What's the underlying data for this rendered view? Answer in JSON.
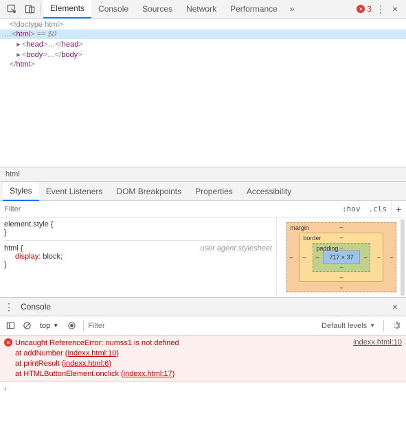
{
  "topbar": {
    "tabs": [
      "Elements",
      "Console",
      "Sources",
      "Network",
      "Performance"
    ],
    "active_tab": 0,
    "error_count": "3"
  },
  "dom": {
    "doctype": "<!doctype html>",
    "html_open": "html",
    "eq0": " == $0",
    "head_open": "head",
    "head_ellipsis": "…",
    "head_close": "head",
    "body_open": "body",
    "body_ellipsis": "…",
    "body_close": "body",
    "html_close": "html"
  },
  "breadcrumb": "html",
  "subtabs": {
    "items": [
      "Styles",
      "Event Listeners",
      "DOM Breakpoints",
      "Properties",
      "Accessibility"
    ],
    "active": 0
  },
  "styles_toolbar": {
    "filter_placeholder": "Filter",
    "hov": ":hov",
    "cls": ".cls"
  },
  "styles_rules": {
    "element_style": "element.style {",
    "close1": "}",
    "html_selector": "html {",
    "ua_label": "user agent stylesheet",
    "prop_name": "display",
    "prop_val": "block",
    "close2": "}"
  },
  "boxmodel": {
    "margin": {
      "label": "margin",
      "t": "–",
      "r": "–",
      "b": "–",
      "l": "–"
    },
    "border": {
      "label": "border",
      "t": "–",
      "r": "–",
      "b": "–",
      "l": "–"
    },
    "padding": {
      "label": "padding",
      "t": "–",
      "r": "–",
      "b": "–",
      "l": "–"
    },
    "content": "717 × 37"
  },
  "drawer": {
    "title": "Console"
  },
  "console_toolbar": {
    "context": "top",
    "filter_placeholder": "Filter",
    "levels": "Default levels"
  },
  "console_msg": {
    "error_title": "Uncaught ReferenceError: numss1 is not defined",
    "at1_pre": "    at addNumber (",
    "at1_link": "indexx.html:10",
    "at2_pre": "    at printResult (",
    "at2_link": "indexx.html:6",
    "at3_pre": "    at HTMLButtonElement.onclick (",
    "at3_link": "indexx.html:17",
    "paren_close": ")",
    "location": "indexx.html:10"
  },
  "prompt": "›"
}
